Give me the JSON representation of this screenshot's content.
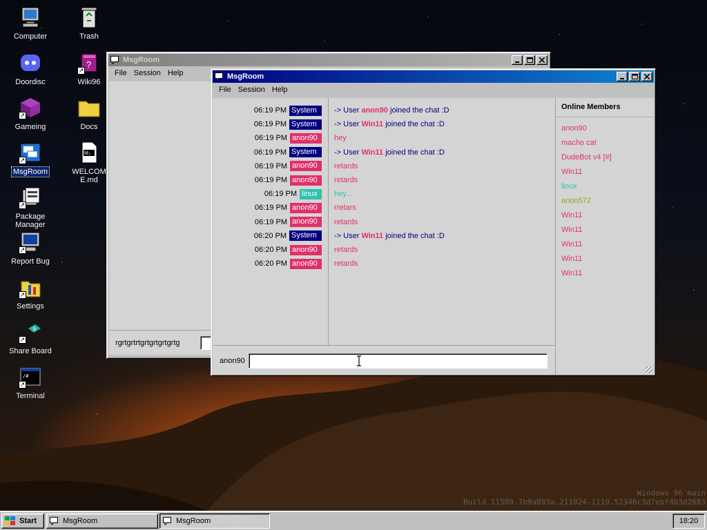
{
  "desktop": {
    "icons": [
      {
        "label": "Computer",
        "icon": "computer-icon"
      },
      {
        "label": "Trash",
        "icon": "trash-icon"
      },
      {
        "label": "Doordisc",
        "icon": "discord-icon"
      },
      {
        "label": "Wiki96",
        "icon": "wiki-book-icon"
      },
      {
        "label": "Gameing",
        "icon": "cube-icon"
      },
      {
        "label": "Docs",
        "icon": "folder-icon"
      },
      {
        "label": "MsgRoom",
        "icon": "msgroom-icon"
      },
      {
        "label": "WELCOME.md",
        "icon": "markdown-file-icon"
      },
      {
        "label": "Package Manager",
        "icon": "package-icon"
      },
      {
        "label": "Report Bug",
        "icon": "monitor-bug-icon"
      },
      {
        "label": "Settings",
        "icon": "settings-icon"
      },
      {
        "label": "Share Board",
        "icon": "share-board-icon"
      },
      {
        "label": "Terminal",
        "icon": "terminal-icon"
      }
    ],
    "watermark": {
      "line1": "Windows 96 main",
      "line2": "Build 11589.7b9a893a.211024-1119.52346c3d7ebf4b3d2683"
    }
  },
  "back_window": {
    "title": "MsgRoom",
    "menu": [
      "File",
      "Session",
      "Help"
    ],
    "input_label": "rgrtgrtrtgrtgrtgrtgrtg"
  },
  "front_window": {
    "title": "MsgRoom",
    "menu": [
      "File",
      "Session",
      "Help"
    ],
    "messages": [
      {
        "time": "06:19 PM",
        "sender": "System",
        "kind": "system",
        "pre": "-> User ",
        "user": "anon90",
        "post": " joined the chat :D"
      },
      {
        "time": "06:19 PM",
        "sender": "System",
        "kind": "system",
        "pre": "-> User ",
        "user": "Win11",
        "post": " joined the chat :D"
      },
      {
        "time": "06:19 PM",
        "sender": "anon90",
        "kind": "anon90",
        "text": "hey"
      },
      {
        "time": "06:19 PM",
        "sender": "System",
        "kind": "system",
        "pre": "-> User ",
        "user": "Win11",
        "post": " joined the chat :D"
      },
      {
        "time": "06:19 PM",
        "sender": "anon90",
        "kind": "anon90",
        "text": "retards"
      },
      {
        "time": "06:19 PM",
        "sender": "anon90",
        "kind": "anon90",
        "text": "retards"
      },
      {
        "time": "06:19 PM",
        "sender": "linux",
        "kind": "linux",
        "text": "hey..."
      },
      {
        "time": "06:19 PM",
        "sender": "anon90",
        "kind": "anon90",
        "text": "rretars"
      },
      {
        "time": "06:19 PM",
        "sender": "anon90",
        "kind": "anon90",
        "text": "retards"
      },
      {
        "time": "06:20 PM",
        "sender": "System",
        "kind": "system",
        "pre": "-> User ",
        "user": "Win11",
        "post": " joined the chat :D"
      },
      {
        "time": "06:20 PM",
        "sender": "anon90",
        "kind": "anon90",
        "text": "retards"
      },
      {
        "time": "06:20 PM",
        "sender": "anon90",
        "kind": "anon90",
        "text": "retards"
      }
    ],
    "members_title": "Online Members",
    "members": [
      {
        "name": "anon90",
        "color": "#e0306a"
      },
      {
        "name": "macho cat",
        "color": "#e0306a"
      },
      {
        "name": "DudeBot v4 [#]",
        "color": "#e0306a"
      },
      {
        "name": "Win11",
        "color": "#e0306a"
      },
      {
        "name": "linux",
        "color": "#30c0b0"
      },
      {
        "name": "anon572",
        "color": "#a0a020"
      },
      {
        "name": "Win11",
        "color": "#e0306a"
      },
      {
        "name": "Win11",
        "color": "#e0306a"
      },
      {
        "name": "Win11",
        "color": "#e0306a"
      },
      {
        "name": "Win11",
        "color": "#e0306a"
      },
      {
        "name": "Win11",
        "color": "#e0306a"
      }
    ],
    "nickname_label": "anon90",
    "message_input_value": ""
  },
  "taskbar": {
    "start_label": "Start",
    "tasks": [
      {
        "label": "MsgRoom",
        "active": false
      },
      {
        "label": "MsgRoom",
        "active": true
      }
    ],
    "clock": "18:20"
  },
  "colors": {
    "system_badge": "#000080",
    "anon90": "#e0306a",
    "linux": "#30c0b0",
    "title_active_start": "#000080",
    "title_active_end": "#1084d0"
  }
}
